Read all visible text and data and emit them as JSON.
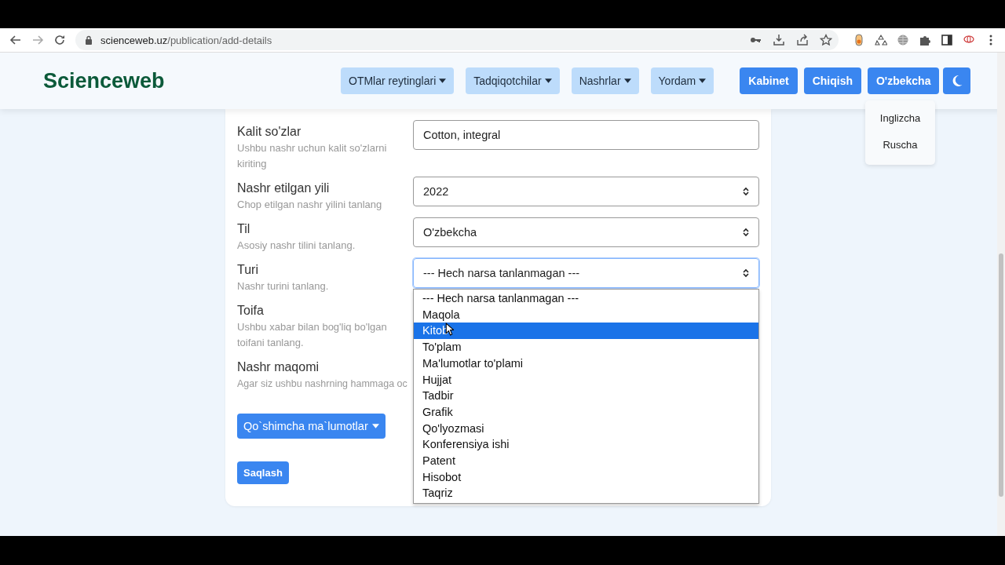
{
  "browser": {
    "url_host": "scienceweb.uz",
    "url_path": "/publication/add-details"
  },
  "header": {
    "logo": "Scienceweb",
    "nav": [
      {
        "label": "OTMlar reytinglari"
      },
      {
        "label": "Tadqiqotchilar"
      },
      {
        "label": "Nashrlar"
      },
      {
        "label": "Yordam"
      }
    ],
    "buttons": [
      {
        "label": "Kabinet"
      },
      {
        "label": "Chiqish"
      },
      {
        "label": "O'zbekcha"
      }
    ],
    "language_menu": [
      {
        "label": "Inglizcha"
      },
      {
        "label": "Ruscha"
      }
    ]
  },
  "form": {
    "fields": [
      {
        "label": "Kalit so'zlar",
        "hint": "Ushbu nashr uchun kalit so'zlarni kiriting",
        "control": {
          "kind": "input",
          "value": "Cotton, integral",
          "focused": false
        }
      },
      {
        "label": "Nashr etilgan yili",
        "hint": "Chop etilgan nashr yilini tanlang",
        "control": {
          "kind": "select",
          "value": "2022",
          "focused": false
        }
      },
      {
        "label": "Til",
        "hint": "Asosiy nashr tilini tanlang.",
        "control": {
          "kind": "select",
          "value": "O'zbekcha",
          "focused": false
        }
      },
      {
        "label": "Turi",
        "hint": "Nashr turini tanlang.",
        "control": {
          "kind": "select",
          "value": "--- Hech narsa tanlanmagan ---",
          "focused": true,
          "open": true
        }
      },
      {
        "label": "Toifa",
        "hint": "Ushbu xabar bilan bog'liq bo'lgan toifani tanlang."
      },
      {
        "label": "Nashr maqomi",
        "hint": "Agar siz ushbu nashrning hammaga oc"
      }
    ],
    "options": [
      {
        "label": "--- Hech narsa tanlanmagan ---",
        "selected": false
      },
      {
        "label": "Maqola",
        "selected": false
      },
      {
        "label": "Kitob",
        "selected": true
      },
      {
        "label": "To'plam",
        "selected": false
      },
      {
        "label": "Ma'lumotlar to'plami",
        "selected": false
      },
      {
        "label": "Hujjat",
        "selected": false
      },
      {
        "label": "Tadbir",
        "selected": false
      },
      {
        "label": "Grafik",
        "selected": false
      },
      {
        "label": "Qo'lyozmasi",
        "selected": false
      },
      {
        "label": "Konferensiya ishi",
        "selected": false
      },
      {
        "label": "Patent",
        "selected": false
      },
      {
        "label": "Hisobot",
        "selected": false
      },
      {
        "label": "Taqriz",
        "selected": false
      }
    ],
    "more_button": "Qo`shimcha ma`lumotlar",
    "save_button": "Saqlash"
  }
}
